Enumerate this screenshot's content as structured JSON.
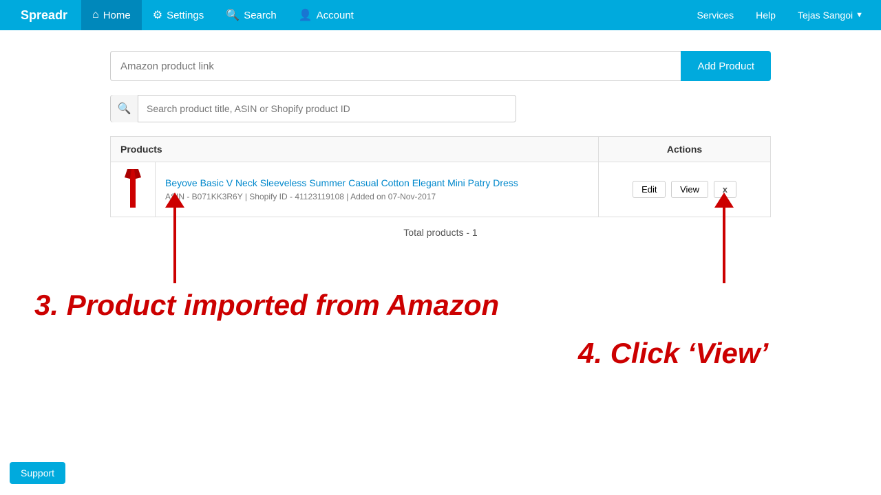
{
  "navbar": {
    "brand": "Spreadr",
    "home_label": "Home",
    "settings_label": "Settings",
    "search_label": "Search",
    "account_label": "Account",
    "services_label": "Services",
    "help_label": "Help",
    "user_label": "Tejas Sangoi"
  },
  "add_product": {
    "input_placeholder": "Amazon product link",
    "button_label": "Add Product"
  },
  "search": {
    "placeholder": "Search product title, ASIN or Shopify product ID"
  },
  "table": {
    "col_products": "Products",
    "col_actions": "Actions",
    "rows": [
      {
        "title": "Beyove Basic V Neck Sleeveless Summer Casual Cotton Elegant Mini Patry Dress",
        "meta": "ASIN - B071KK3R6Y  |  Shopify ID - 41123119108  |  Added on 07-Nov-2017",
        "edit_label": "Edit",
        "view_label": "View",
        "delete_label": "x"
      }
    ]
  },
  "total_products": "Total products - 1",
  "annotations": {
    "step3": "3. Product imported from Amazon",
    "step4": "4. Click ‘View’"
  },
  "support": {
    "label": "Support"
  }
}
